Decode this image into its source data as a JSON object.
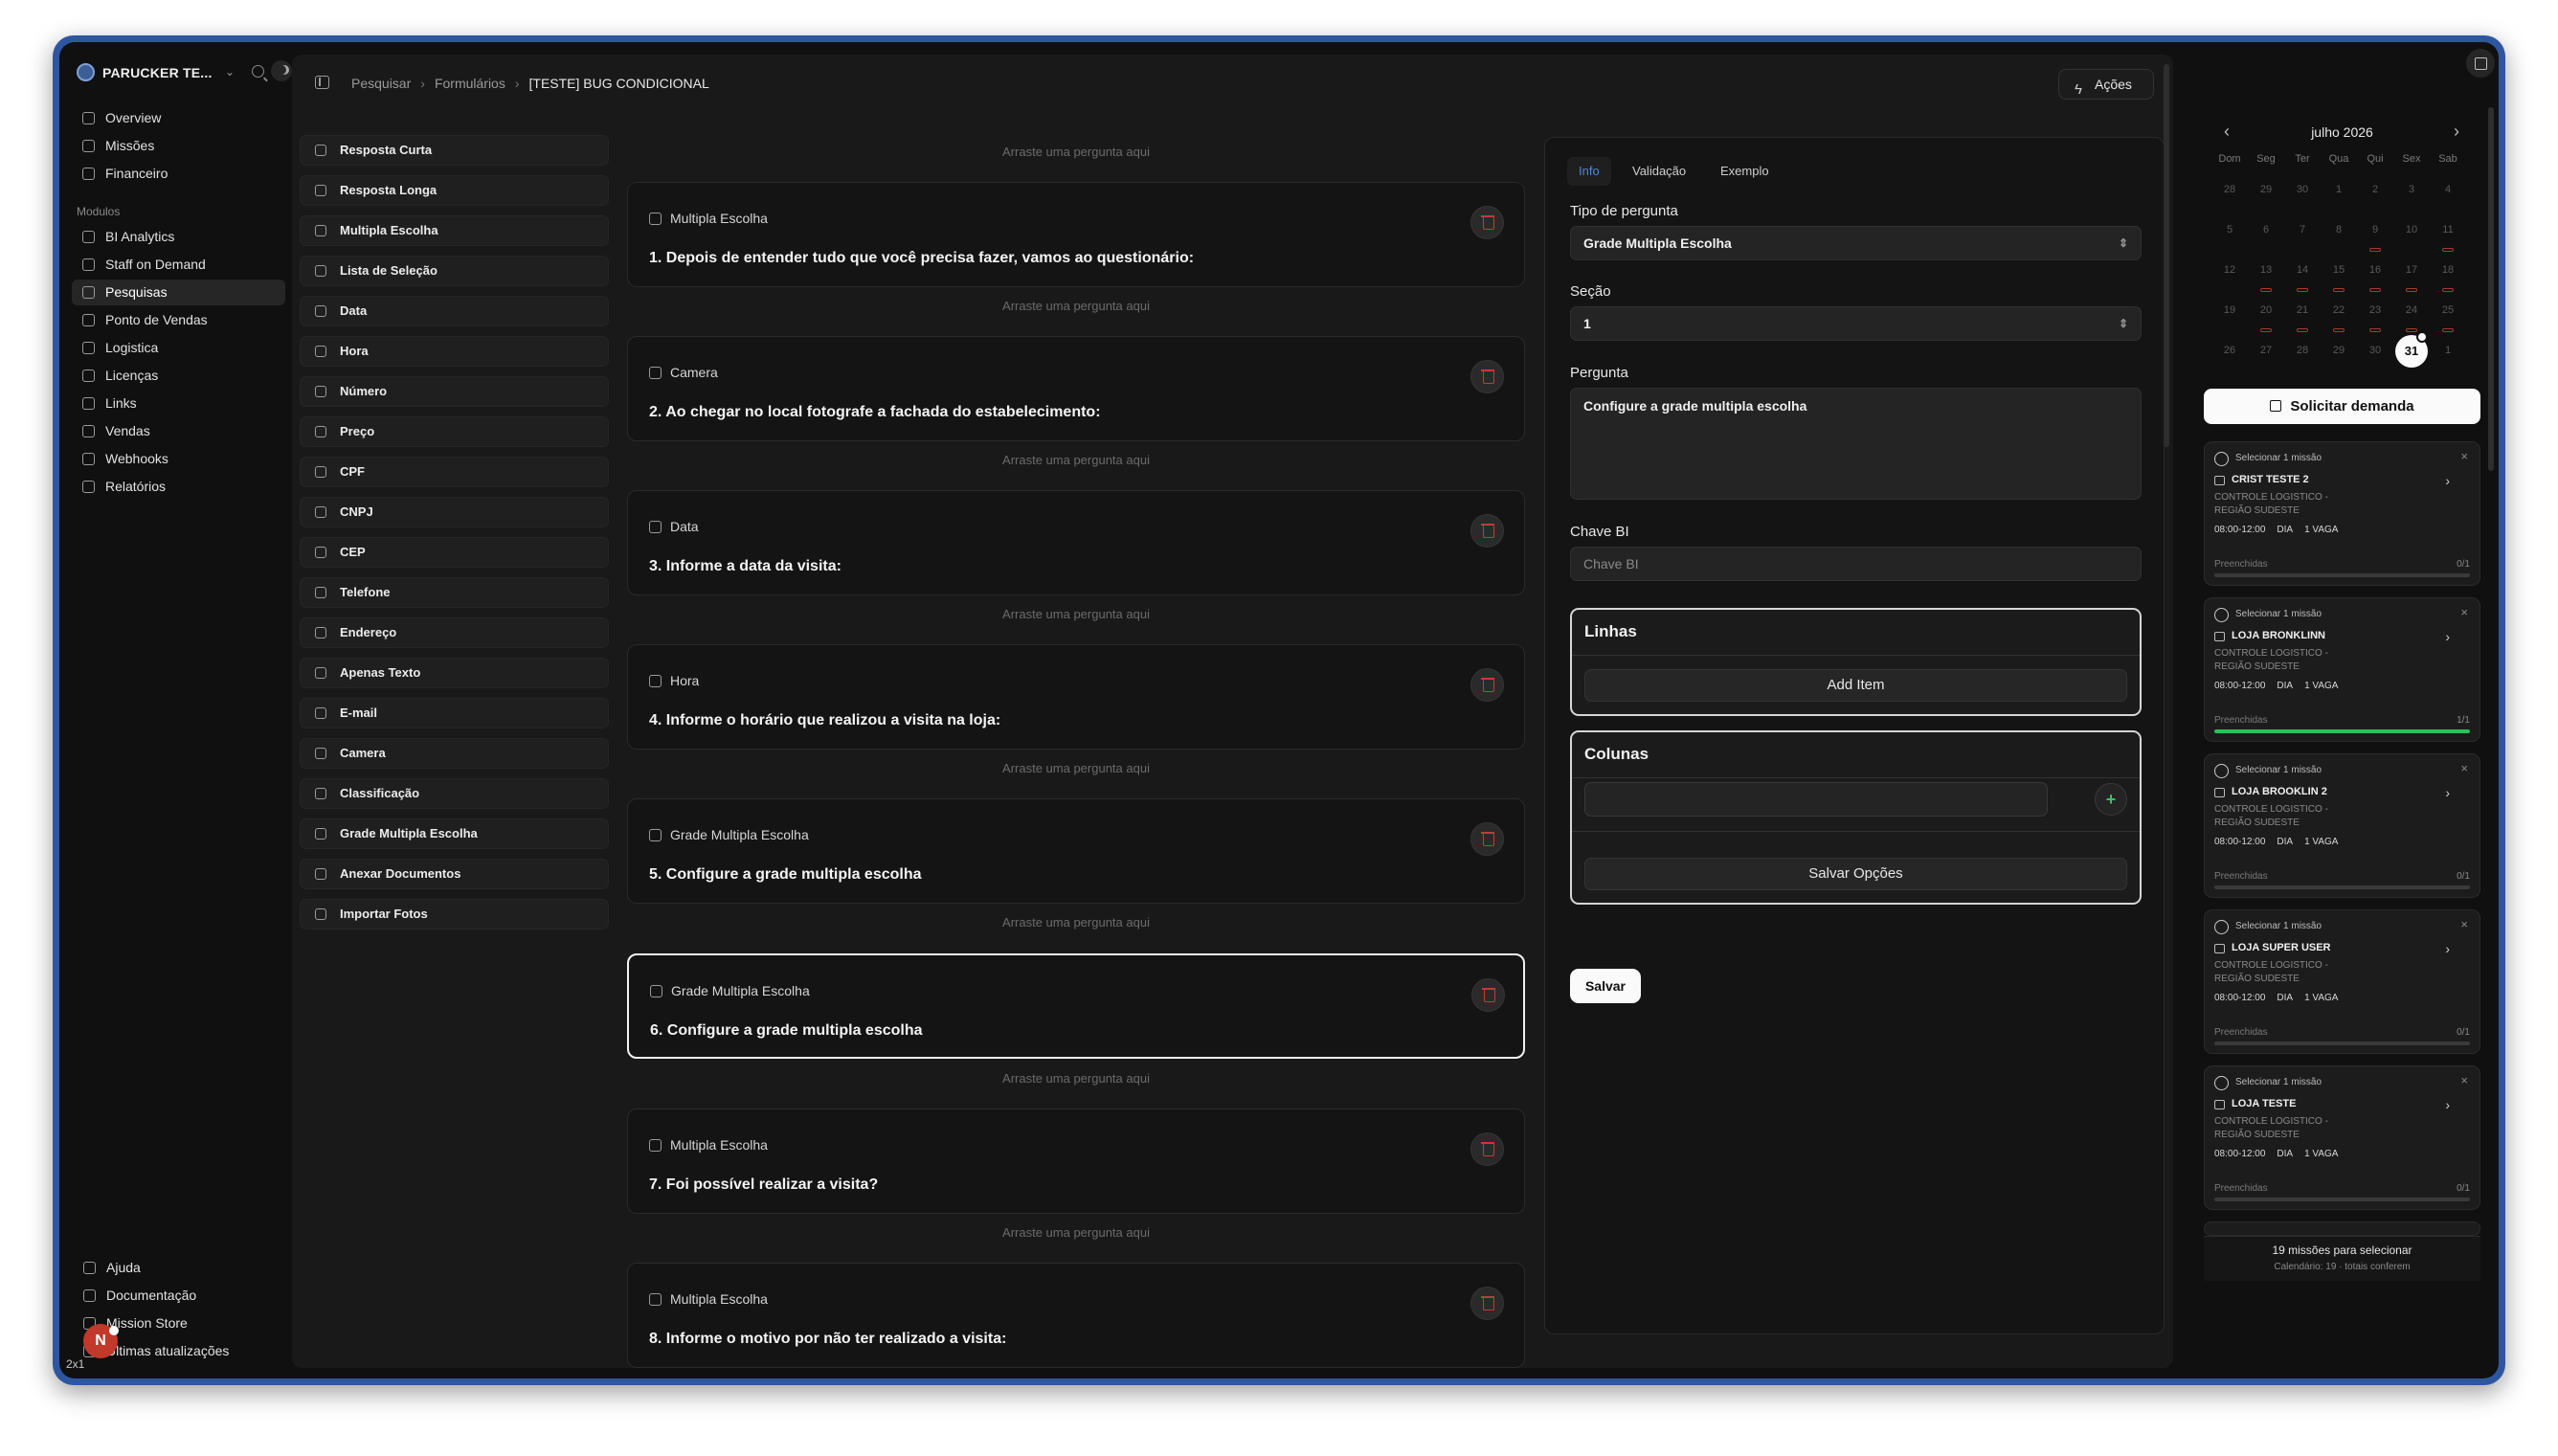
{
  "sidebar": {
    "company": "PARUCKER TE...",
    "nav": [
      {
        "label": "Overview",
        "icon": "overview-icon"
      },
      {
        "label": "Missões",
        "icon": "rocket-icon"
      },
      {
        "label": "Financeiro",
        "icon": "wallet-icon"
      }
    ],
    "modules_title": "Modulos",
    "modules": [
      {
        "label": "BI Analytics",
        "icon": "chart-icon",
        "active": false
      },
      {
        "label": "Staff on Demand",
        "icon": "users-icon",
        "active": false
      },
      {
        "label": "Pesquisas",
        "icon": "clipboard-icon",
        "active": true
      },
      {
        "label": "Ponto de Vendas",
        "icon": "store-icon",
        "active": false
      },
      {
        "label": "Logistica",
        "icon": "truck-icon",
        "active": false
      },
      {
        "label": "Licenças",
        "icon": "license-icon",
        "active": false
      },
      {
        "label": "Links",
        "icon": "link-icon",
        "active": false
      },
      {
        "label": "Vendas",
        "icon": "tag-icon",
        "active": false
      },
      {
        "label": "Webhooks",
        "icon": "webhook-icon",
        "active": false
      },
      {
        "label": "Relatórios",
        "icon": "report-icon",
        "active": false
      }
    ],
    "footer": [
      {
        "label": "Ajuda",
        "icon": "help-icon"
      },
      {
        "label": "Documentação",
        "icon": "book-icon"
      },
      {
        "label": "Mission Store",
        "icon": "store-icon"
      },
      {
        "label": "Últimas atualizações",
        "icon": "bell-icon"
      }
    ],
    "avatar_letter": "N",
    "zoom": "2x1"
  },
  "breadcrumbs": [
    "Pesquisar",
    "Formulários",
    "[TESTE] BUG CONDICIONAL"
  ],
  "actions_label": "Ações",
  "palette": [
    {
      "label": "Resposta Curta",
      "icon": "text-cursor-icon"
    },
    {
      "label": "Resposta Longa",
      "icon": "paragraph-icon"
    },
    {
      "label": "Multipla Escolha",
      "icon": "multiple-choice-icon"
    },
    {
      "label": "Lista de Seleção",
      "icon": "list-icon"
    },
    {
      "label": "Data",
      "icon": "calendar-icon"
    },
    {
      "label": "Hora",
      "icon": "clock-icon"
    },
    {
      "label": "Número",
      "icon": "number-icon"
    },
    {
      "label": "Preço",
      "icon": "price-icon"
    },
    {
      "label": "CPF",
      "icon": "id-icon"
    },
    {
      "label": "CNPJ",
      "icon": "building-icon"
    },
    {
      "label": "CEP",
      "icon": "map-pin-icon"
    },
    {
      "label": "Telefone",
      "icon": "phone-icon"
    },
    {
      "label": "Endereço",
      "icon": "address-icon"
    },
    {
      "label": "Apenas Texto",
      "icon": "text-icon"
    },
    {
      "label": "E-mail",
      "icon": "mail-icon"
    },
    {
      "label": "Camera",
      "icon": "camera-icon"
    },
    {
      "label": "Classificação",
      "icon": "star-icon"
    },
    {
      "label": "Grade Multipla Escolha",
      "icon": "grid-icon"
    },
    {
      "label": "Anexar Documentos",
      "icon": "attach-icon"
    },
    {
      "label": "Importar Fotos",
      "icon": "photos-icon"
    }
  ],
  "dropzone_label": "Arraste uma pergunta aqui",
  "questions": [
    {
      "type": "Multipla Escolha",
      "title": "1. Depois de entender tudo que você precisa fazer, vamos ao questionário:",
      "icon": "multiple-choice-icon",
      "selected": false
    },
    {
      "type": "Camera",
      "title": "2. Ao chegar no local fotografe a fachada do estabelecimento:",
      "icon": "camera-icon",
      "selected": false
    },
    {
      "type": "Data",
      "title": "3. Informe a data da visita:",
      "icon": "calendar-icon",
      "selected": false
    },
    {
      "type": "Hora",
      "title": "4. Informe o horário que realizou a visita na loja:",
      "icon": "clock-icon",
      "selected": false
    },
    {
      "type": "Grade Multipla Escolha",
      "title": "5. Configure a grade multipla escolha",
      "icon": "grid-icon",
      "selected": false
    },
    {
      "type": "Grade Multipla Escolha",
      "title": "6. Configure a grade multipla escolha",
      "icon": "grid-icon",
      "selected": true
    },
    {
      "type": "Multipla Escolha",
      "title": "7. Foi possível realizar a visita?",
      "icon": "multiple-choice-icon",
      "selected": false
    },
    {
      "type": "Multipla Escolha",
      "title": "8. Informe o motivo por não ter realizado a visita:",
      "icon": "multiple-choice-icon",
      "selected": false
    }
  ],
  "panel": {
    "tabs": [
      "Info",
      "Validação",
      "Exemplo"
    ],
    "active_tab": "Info",
    "tipo_label": "Tipo de pergunta",
    "tipo_value": "Grade Multipla Escolha",
    "secao_label": "Seção",
    "secao_value": "1",
    "pergunta_label": "Pergunta",
    "pergunta_value": "Configure a grade multipla escolha",
    "chave_label": "Chave BI",
    "chave_placeholder": "Chave BI",
    "linhas_title": "Linhas",
    "add_item_label": "Add Item",
    "colunas_title": "Colunas",
    "salvar_opcoes_label": "Salvar Opções",
    "salvar_label": "Salvar"
  },
  "calendar": {
    "month": "julho 2026",
    "weekdays": [
      "Dom",
      "Seg",
      "Ter",
      "Qua",
      "Qui",
      "Sex",
      "Sab"
    ],
    "days": [
      28,
      29,
      30,
      1,
      2,
      3,
      4,
      5,
      6,
      7,
      8,
      9,
      10,
      11,
      12,
      13,
      14,
      15,
      16,
      17,
      18,
      19,
      20,
      21,
      22,
      23,
      24,
      25,
      26,
      27,
      28,
      29,
      30,
      31,
      1
    ],
    "today": 31,
    "marked_days": [
      16,
      18,
      13,
      14,
      15,
      16,
      17,
      20,
      21,
      22,
      23,
      24,
      25,
      28,
      30
    ]
  },
  "solicitar_label": "Solicitar demanda",
  "missions": [
    {
      "select": "Selecionar 1 missão",
      "name": "CRIST TESTE 2",
      "sub": "CONTROLE LOGISTICO - REGIÃO SUDESTE",
      "time": "08:00-12:00",
      "period": "DIA",
      "vagas": "1 VAGA",
      "filled_label": "Preenchidas",
      "filled": "0/1",
      "progress": 0
    },
    {
      "select": "Selecionar 1 missão",
      "name": "LOJA BRONKLINN",
      "sub": "CONTROLE LOGISTICO - REGIÃO SUDESTE",
      "time": "08:00-12:00",
      "period": "DIA",
      "vagas": "1 VAGA",
      "filled_label": "Preenchidas",
      "filled": "1/1",
      "progress": 1
    },
    {
      "select": "Selecionar 1 missão",
      "name": "LOJA BROOKLIN 2",
      "sub": "CONTROLE LOGISTICO - REGIÃO SUDESTE",
      "time": "08:00-12:00",
      "period": "DIA",
      "vagas": "1 VAGA",
      "filled_label": "Preenchidas",
      "filled": "0/1",
      "progress": 0
    },
    {
      "select": "Selecionar 1 missão",
      "name": "LOJA SUPER USER",
      "sub": "CONTROLE LOGISTICO - REGIÃO SUDESTE",
      "time": "08:00-12:00",
      "period": "DIA",
      "vagas": "1 VAGA",
      "filled_label": "Preenchidas",
      "filled": "0/1",
      "progress": 0
    },
    {
      "select": "Selecionar 1 missão",
      "name": "LOJA TESTE",
      "sub": "CONTROLE LOGISTICO - REGIÃO SUDESTE",
      "time": "08:00-12:00",
      "period": "DIA",
      "vagas": "1 VAGA",
      "filled_label": "Preenchidas",
      "filled": "0/1",
      "progress": 0
    }
  ],
  "footer_summary": "19 missões para selecionar",
  "footer_detail": "Calendário: 19 · totais conferem",
  "colors": {
    "accent": "#4d86d9",
    "success": "#2fbf5a",
    "danger": "#c23b3b",
    "frame": "#2e56a0"
  }
}
